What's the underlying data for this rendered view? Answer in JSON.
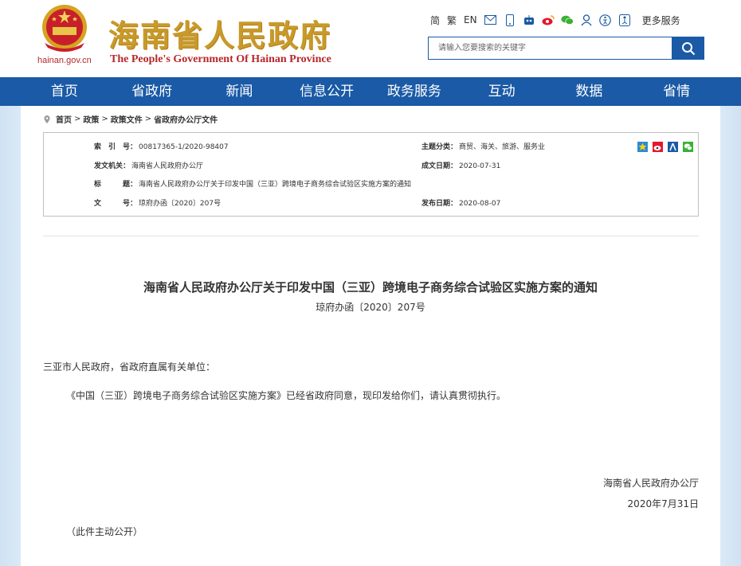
{
  "header": {
    "domain": "hainan.gov.cn",
    "title_cn": "海南省人民政府",
    "title_en": "The People's Government Of Hainan Province",
    "lang_links": [
      "简",
      "繁",
      "EN"
    ],
    "more_services": "更多服务",
    "search_placeholder": "请输入您要搜索的关键字",
    "icons": [
      "envelope-icon",
      "mobile-icon",
      "robot-icon",
      "weibo-icon",
      "wechat-icon",
      "user-icon",
      "accessibility-icon",
      "elder-icon"
    ]
  },
  "nav": [
    "首页",
    "省政府",
    "新闻",
    "信息公开",
    "政务服务",
    "互动",
    "数据",
    "省情"
  ],
  "breadcrumb": [
    "首页",
    "政策",
    "政策文件",
    "省政府办公厅文件"
  ],
  "meta": {
    "index_label": "索　引　号：",
    "index_value": "00817365-1/2020-98407",
    "category_label": "主题分类：",
    "category_value": "商贸、海关、旅游、服务业",
    "issuer_label": "发文机关：",
    "issuer_value": "海南省人民政府办公厅",
    "date_label": "成文日期：",
    "date_value": "2020-07-31",
    "title_label": "标　　　题：",
    "title_value": "海南省人民政府办公厅关于印发中国（三亚）跨境电子商务综合试验区实施方案的通知",
    "docno_label": "文　　　号：",
    "docno_value": "琼府办函〔2020〕207号",
    "publish_label": "发布日期：",
    "publish_value": "2020-08-07"
  },
  "document": {
    "title": "海南省人民政府办公厅关于印发中国（三亚）跨境电子商务综合试验区实施方案的通知",
    "number": "琼府办函〔2020〕207号",
    "salutation": "三亚市人民政府，省政府直属有关单位：",
    "paragraph": "《中国（三亚）跨境电子商务综合试验区实施方案》已经省政府同意，现印发给你们，请认真贯彻执行。",
    "signer": "海南省人民政府办公厅",
    "sign_date": "2020年7月31日",
    "note": "（此件主动公开）"
  },
  "colors": {
    "brand_blue": "#1a5aa6",
    "title_gold": "#c79a2a",
    "brand_red": "#b8262a"
  }
}
